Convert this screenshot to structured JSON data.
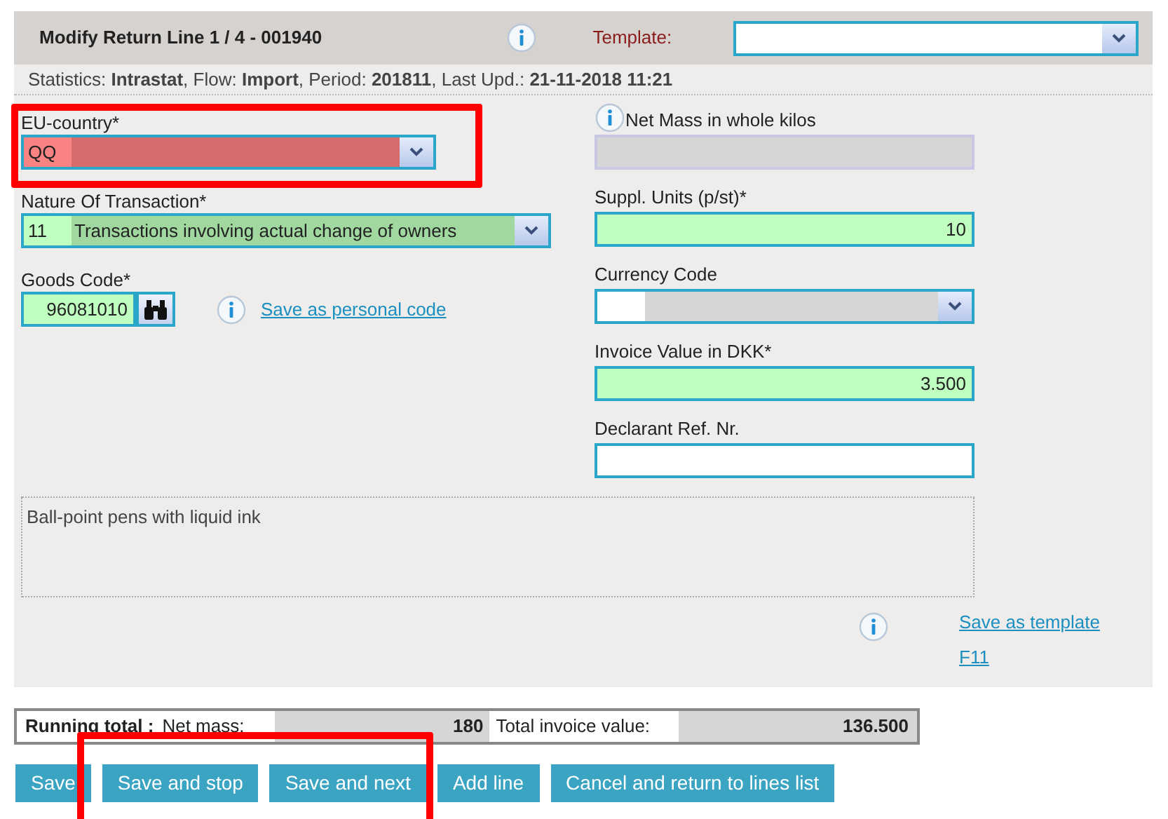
{
  "header": {
    "title": "Modify Return Line 1 / 4 - 001940",
    "template_label": "Template:"
  },
  "statistics": "Statistics: **Intrastat**, Flow: **Import**, Period: **201811**, Last Upd.: **21-11-2018 11:21**",
  "left_fields": [
    {
      "kind": "select",
      "label": "EU-country*",
      "code": "QQ",
      "error": true,
      "required": true,
      "disabled": false
    },
    {
      "kind": "select",
      "label": "Nature Of Transaction*",
      "code": "11",
      "text": "Transactions involving actual change of owners",
      "error": false,
      "required": true,
      "disabled": false
    },
    {
      "kind": "lookup",
      "label": "Goods Code*",
      "value": "96081010",
      "error": false,
      "required": true,
      "disabled": false,
      "link": "Save as personal code"
    }
  ],
  "right_fields": [
    {
      "kind": "text",
      "label": "Net Mass in whole kilos",
      "error": false,
      "required": false,
      "disabled": true,
      "info": true
    },
    {
      "kind": "text",
      "label": "Suppl. Units (p/st)*",
      "value": "10",
      "error": false,
      "required": true,
      "disabled": false,
      "info": false
    },
    {
      "kind": "select",
      "label": "Currency Code",
      "error": false,
      "required": false,
      "disabled": false,
      "info": false
    },
    {
      "kind": "text",
      "label": "Invoice Value in DKK*",
      "value": "3.500",
      "error": false,
      "required": true,
      "disabled": false,
      "info": false
    },
    {
      "kind": "text",
      "label": "Declarant Ref. Nr.",
      "error": false,
      "required": false,
      "disabled": false,
      "info": false
    }
  ],
  "description": "Ball-point pens with liquid ink",
  "template_link": {
    "label": "Save as template",
    "shortcut": "F11"
  },
  "running_total": {
    "label": "Running total :",
    "net_mass_label": "Net mass:",
    "net_mass": "180",
    "invoice_label": "Total invoice value:",
    "invoice": "136.500"
  },
  "buttons": [
    "Save",
    "Save and stop",
    "Save and next",
    "Add line",
    "Cancel and return to lines list"
  ]
}
